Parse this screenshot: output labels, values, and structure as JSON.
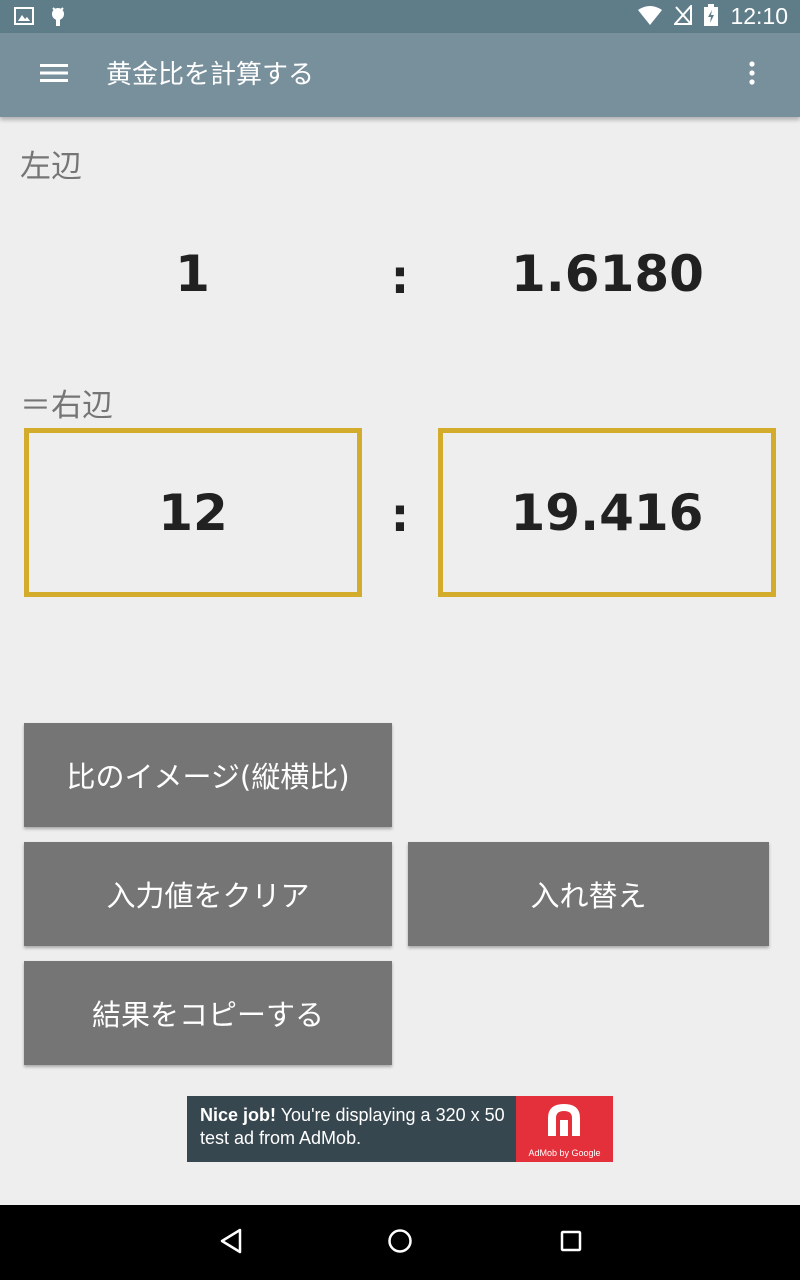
{
  "status_bar": {
    "time": "12:10",
    "icons": [
      "image-icon",
      "android-debug-icon",
      "wifi-icon",
      "no-signal-icon",
      "battery-charging-icon"
    ]
  },
  "app_bar": {
    "title": "黄金比を計算する",
    "icons": [
      "menu-icon",
      "overflow-menu-icon"
    ]
  },
  "left_side": {
    "label": "左辺",
    "value_a": "1",
    "separator": ":",
    "value_b": "1.6180"
  },
  "right_side": {
    "label": "＝右辺",
    "input_a": "12",
    "separator": ":",
    "input_b": "19.416"
  },
  "buttons": {
    "aspect_image": "比のイメージ(縦横比)",
    "clear_input": "入力値をクリア",
    "swap": "入れ替え",
    "copy_result": "結果をコピーする"
  },
  "ad": {
    "headline": "Nice job!",
    "body": " You're displaying a 320 x 50 test ad from AdMob.",
    "logo_text": "AdMob by Google"
  },
  "colors": {
    "status_bar": "#5f7d89",
    "app_bar": "#78909c",
    "input_border": "#d4ac2b",
    "button": "#757575",
    "ad_bg": "#37474f",
    "ad_logo": "#e4303a"
  }
}
